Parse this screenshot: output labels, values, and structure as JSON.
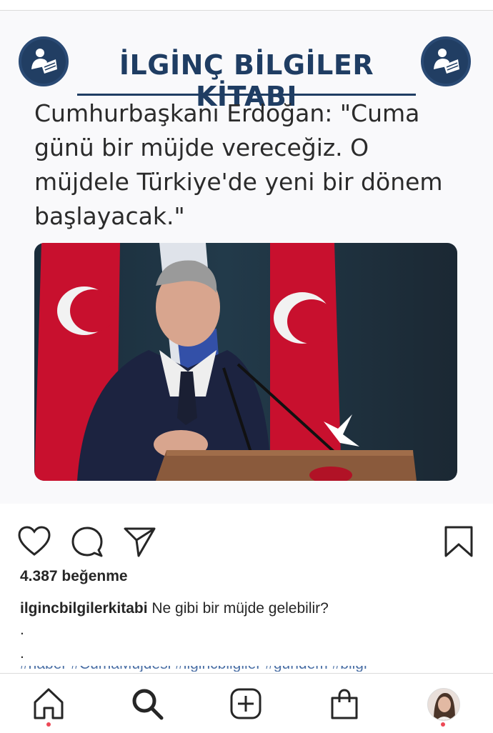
{
  "post": {
    "brand_title": "İLGİNÇ BİLGİLER KİTABI",
    "headline_lines": [
      "Cumhurbaşkanı Erdoğan: \"Cuma",
      "günü bir müjde vereceğiz. O",
      "müjdele Türkiye'de yeni bir dönem",
      "başlayacak.\""
    ],
    "photo_icon": "news-photo"
  },
  "actions": {
    "like_icon": "heart-icon",
    "comment_icon": "comment-icon",
    "share_icon": "send-icon",
    "save_icon": "bookmark-icon"
  },
  "likes_text": "4.387 beğenme",
  "caption": {
    "username": "ilgincbilgilerkitabi",
    "text": " Ne gibi bir müjde gelebilir?"
  },
  "caption_dots": [
    ".",
    "."
  ],
  "clipped_hashtags": "#haber #CumaMüjdesi #ilgincbilgiler #gundem #bilgi",
  "nav": {
    "items": [
      "home-icon",
      "search-icon",
      "new-post-icon",
      "shop-icon",
      "profile-avatar"
    ]
  },
  "colors": {
    "brand": "#1f3d63",
    "notification_dot": "#ed4956"
  }
}
